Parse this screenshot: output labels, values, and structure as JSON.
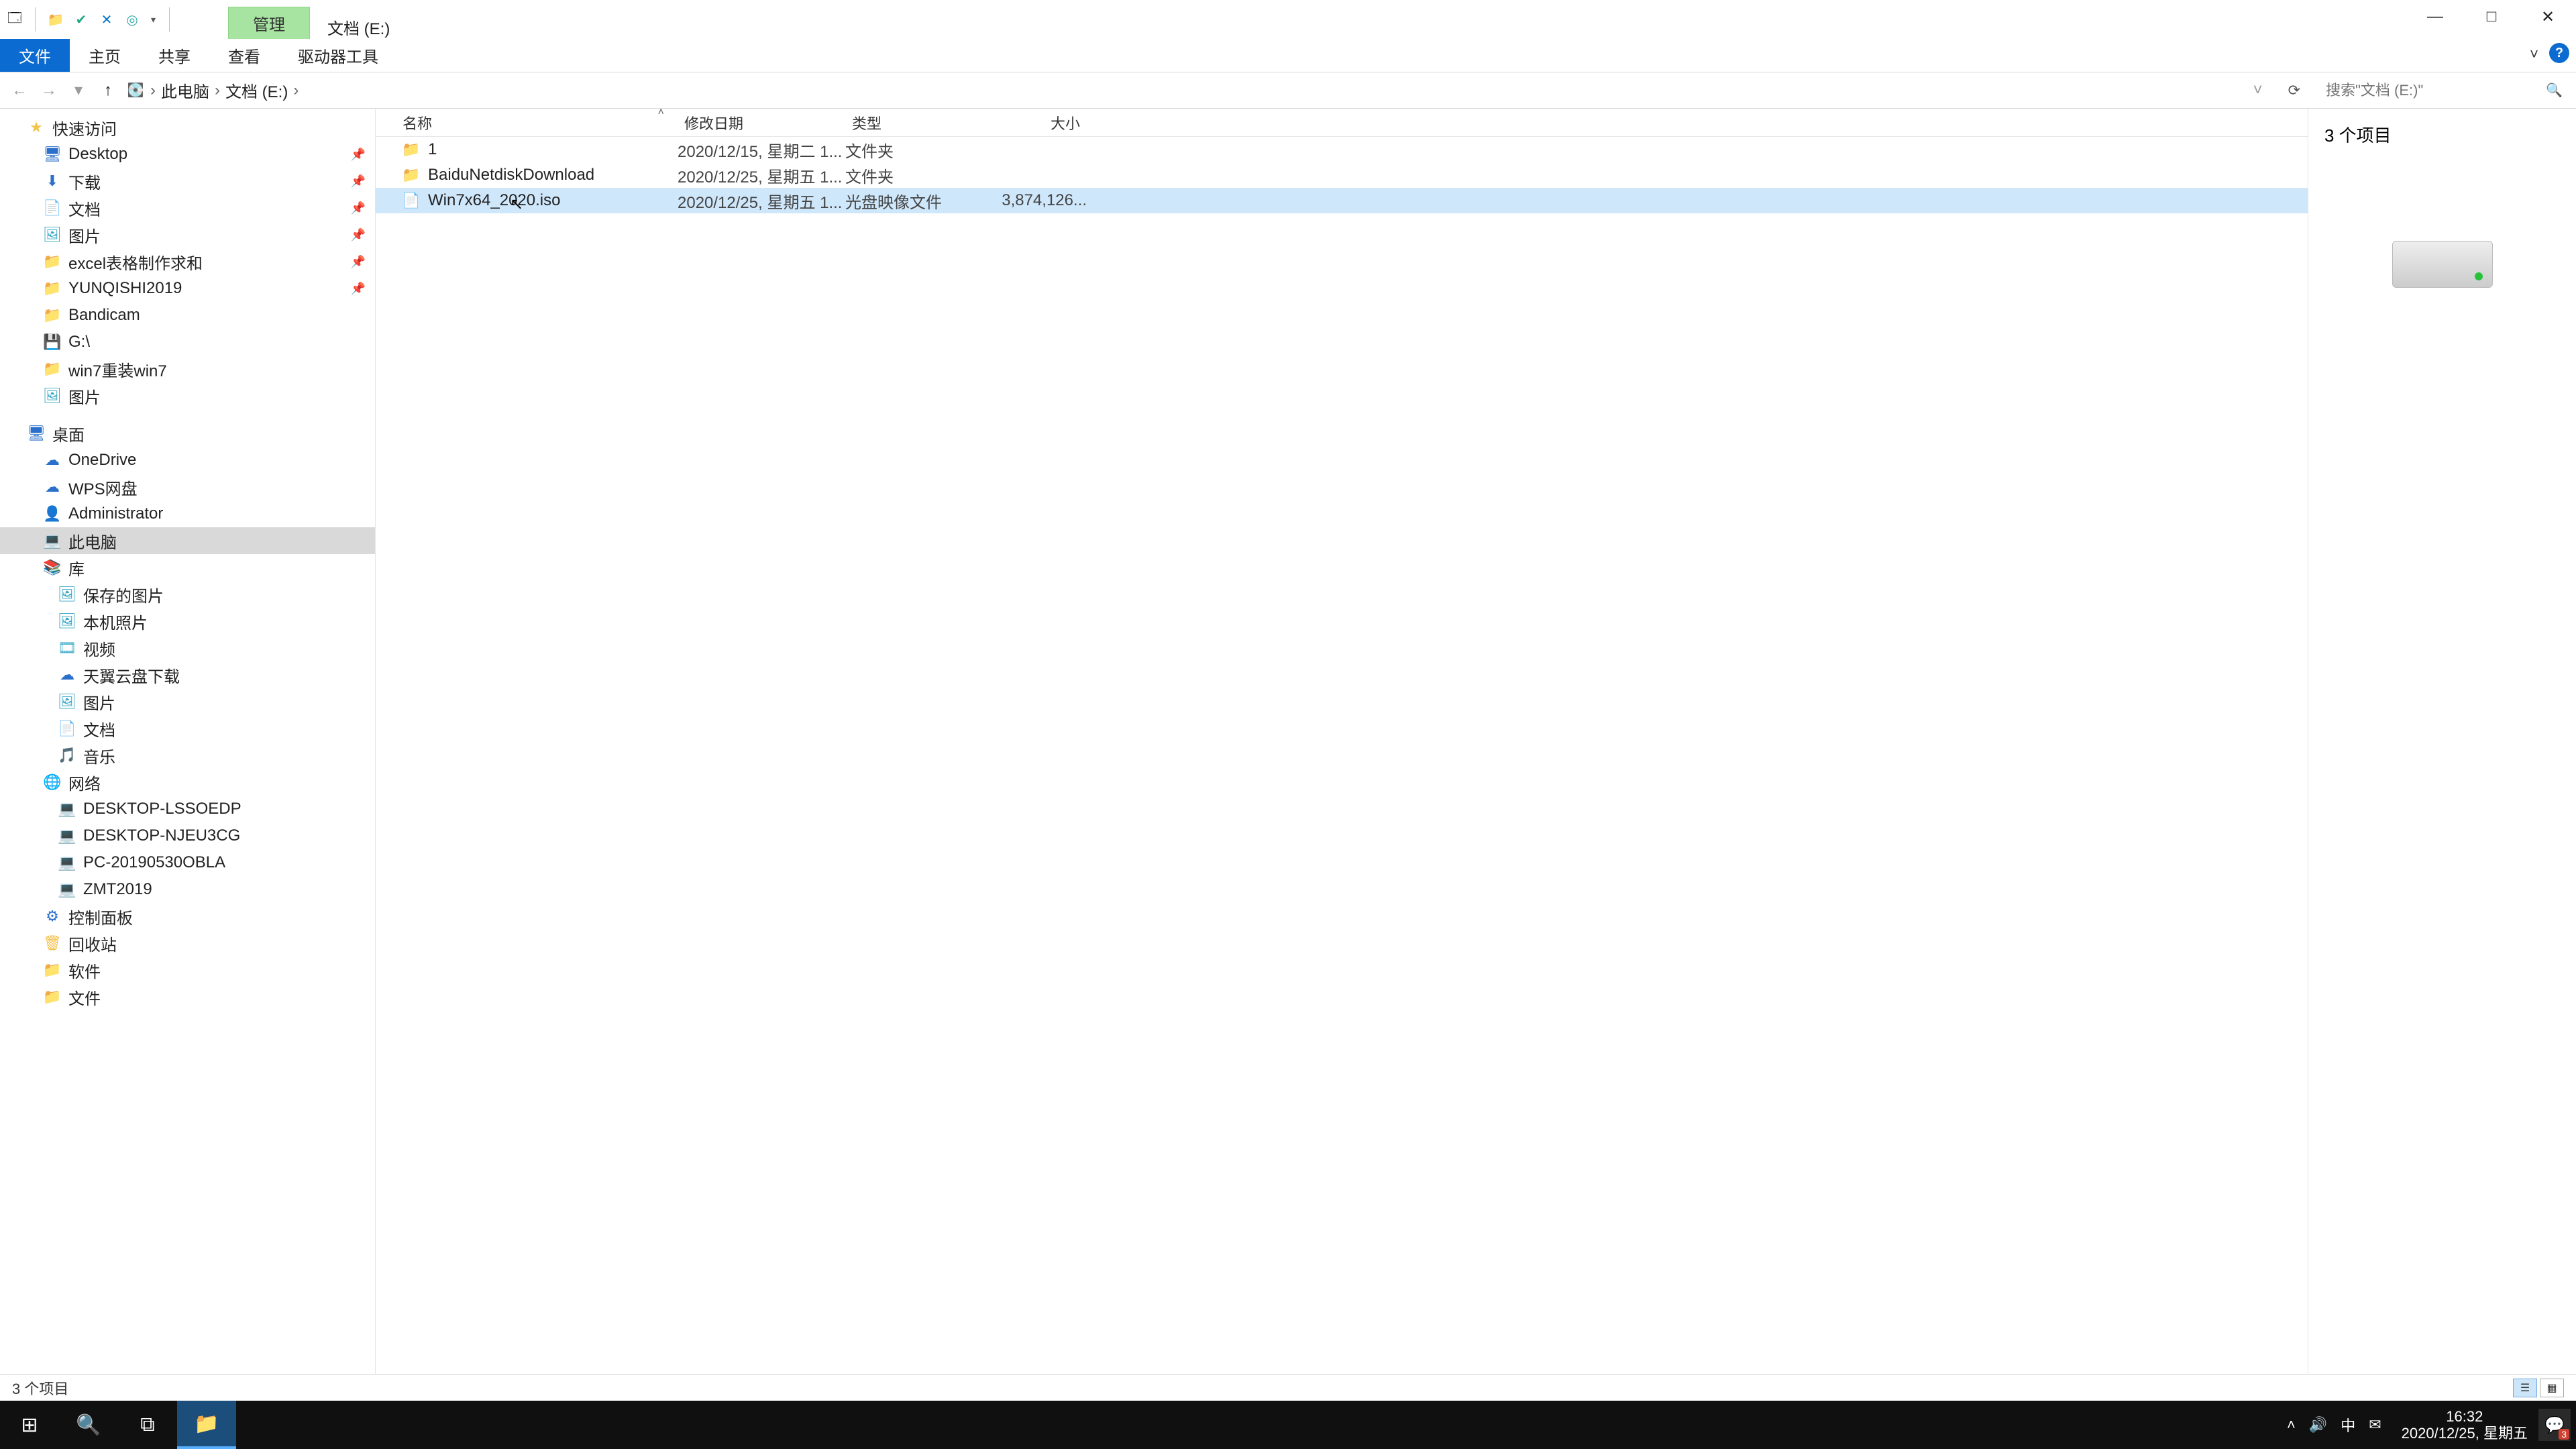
{
  "qat": {
    "dropdown_glyph": "▾"
  },
  "title": {
    "manage": "管理",
    "window": "文档 (E:)"
  },
  "win": {
    "min": "—",
    "max": "□",
    "close": "✕"
  },
  "ribbon": {
    "file": "文件",
    "home": "主页",
    "share": "共享",
    "view": "查看",
    "drive": "驱动器工具"
  },
  "nav": {
    "back": "←",
    "fwd": "→",
    "hist": "▾",
    "up": "↑"
  },
  "addr": {
    "root": "此电脑",
    "loc": "文档 (E:)",
    "sep": "›"
  },
  "search": {
    "placeholder": "搜索\"文档 (E:)\"",
    "refresh": "⟳",
    "icon": "🔍"
  },
  "cols": {
    "name": "名称",
    "date": "修改日期",
    "type": "类型",
    "size": "大小"
  },
  "rows": [
    {
      "icon": "📁",
      "cls": "g-folder",
      "name": "1",
      "date": "2020/12/15, 星期二 1...",
      "type": "文件夹",
      "size": ""
    },
    {
      "icon": "📁",
      "cls": "g-folder",
      "name": "BaiduNetdiskDownload",
      "date": "2020/12/25, 星期五 1...",
      "type": "文件夹",
      "size": ""
    },
    {
      "icon": "📄",
      "cls": "g-file",
      "name": "Win7x64_2020.iso",
      "date": "2020/12/25, 星期五 1...",
      "type": "光盘映像文件",
      "size": "3,874,126...",
      "sel": true
    }
  ],
  "tree": [
    {
      "ico": "★",
      "cls": "g-star",
      "txt": "快速访问",
      "ind": "ind1"
    },
    {
      "ico": "🖥",
      "cls": "g-blue",
      "txt": "Desktop",
      "ind": "ind2",
      "pin": true
    },
    {
      "ico": "⬇",
      "cls": "g-blue",
      "txt": "下载",
      "ind": "ind2",
      "pin": true
    },
    {
      "ico": "📄",
      "cls": "g-folder",
      "txt": "文档",
      "ind": "ind2",
      "pin": true
    },
    {
      "ico": "🖼",
      "cls": "g-pic",
      "txt": "图片",
      "ind": "ind2",
      "pin": true
    },
    {
      "ico": "📁",
      "cls": "g-folder",
      "txt": "excel表格制作求和",
      "ind": "ind2",
      "pin": true
    },
    {
      "ico": "📁",
      "cls": "g-folder",
      "txt": "YUNQISHI2019",
      "ind": "ind2",
      "pin": true
    },
    {
      "ico": "📁",
      "cls": "g-folder",
      "txt": "Bandicam",
      "ind": "ind2"
    },
    {
      "ico": "💾",
      "cls": "g-blue",
      "txt": "G:\\",
      "ind": "ind2"
    },
    {
      "ico": "📁",
      "cls": "g-folder",
      "txt": "win7重装win7",
      "ind": "ind2"
    },
    {
      "ico": "🖼",
      "cls": "g-pic",
      "txt": "图片",
      "ind": "ind2"
    },
    {
      "spacer": true
    },
    {
      "ico": "🖥",
      "cls": "g-blue",
      "txt": "桌面",
      "ind": "ind1"
    },
    {
      "ico": "☁",
      "cls": "g-blue",
      "txt": "OneDrive",
      "ind": "ind2"
    },
    {
      "ico": "☁",
      "cls": "g-blue",
      "txt": "WPS网盘",
      "ind": "ind2"
    },
    {
      "ico": "👤",
      "cls": "g-folder",
      "txt": "Administrator",
      "ind": "ind2"
    },
    {
      "ico": "💻",
      "cls": "g-pc",
      "txt": "此电脑",
      "ind": "ind2",
      "sel": true
    },
    {
      "ico": "📚",
      "cls": "g-folder",
      "txt": "库",
      "ind": "ind2"
    },
    {
      "ico": "🖼",
      "cls": "g-pic",
      "txt": "保存的图片",
      "ind": "ind3"
    },
    {
      "ico": "🖼",
      "cls": "g-pic",
      "txt": "本机照片",
      "ind": "ind3"
    },
    {
      "ico": "🎞",
      "cls": "g-pic",
      "txt": "视频",
      "ind": "ind3"
    },
    {
      "ico": "☁",
      "cls": "g-blue",
      "txt": "天翼云盘下载",
      "ind": "ind3"
    },
    {
      "ico": "🖼",
      "cls": "g-pic",
      "txt": "图片",
      "ind": "ind3"
    },
    {
      "ico": "📄",
      "cls": "g-folder",
      "txt": "文档",
      "ind": "ind3"
    },
    {
      "ico": "🎵",
      "cls": "g-folder",
      "txt": "音乐",
      "ind": "ind3"
    },
    {
      "ico": "🌐",
      "cls": "g-net",
      "txt": "网络",
      "ind": "ind2"
    },
    {
      "ico": "💻",
      "cls": "g-pc",
      "txt": "DESKTOP-LSSOEDP",
      "ind": "ind3"
    },
    {
      "ico": "💻",
      "cls": "g-pc",
      "txt": "DESKTOP-NJEU3CG",
      "ind": "ind3"
    },
    {
      "ico": "💻",
      "cls": "g-pc",
      "txt": "PC-20190530OBLA",
      "ind": "ind3"
    },
    {
      "ico": "💻",
      "cls": "g-pc",
      "txt": "ZMT2019",
      "ind": "ind3"
    },
    {
      "ico": "⚙",
      "cls": "g-blue",
      "txt": "控制面板",
      "ind": "ind2"
    },
    {
      "ico": "🗑",
      "cls": "g-folder",
      "txt": "回收站",
      "ind": "ind2"
    },
    {
      "ico": "📁",
      "cls": "g-folder",
      "txt": "软件",
      "ind": "ind2"
    },
    {
      "ico": "📁",
      "cls": "g-folder",
      "txt": "文件",
      "ind": "ind2"
    }
  ],
  "preview": {
    "count": "3 个项目"
  },
  "status": {
    "count": "3 个项目"
  },
  "taskbar": {
    "start": "⊞",
    "search": "🔍",
    "taskview": "⧉",
    "explorer": "📁",
    "tray_up": "˄",
    "vol": "🔊",
    "ime": "中",
    "mail": "✉",
    "time": "16:32",
    "date": "2020/12/25, 星期五",
    "notif": "💬",
    "badge": "3"
  }
}
